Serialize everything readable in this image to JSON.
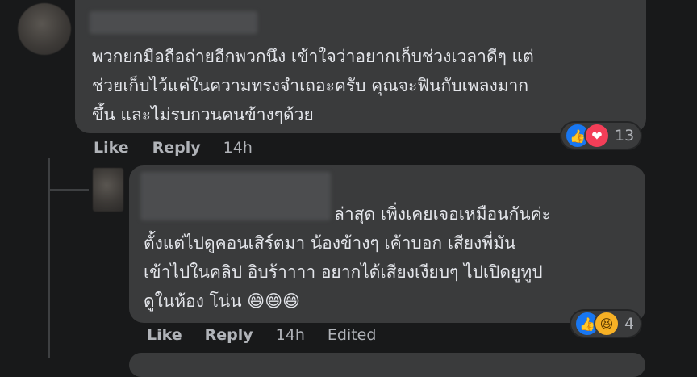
{
  "comment1": {
    "text": "พวกยกมือถือถ่ายอีกพวกนึง เข้าใจว่าอยากเก็บช่วงเวลาดีๆ แต่\nช่วยเก็บไว้แค่ในความทรงจำเถอะครับ คุณจะฟินกับเพลงมาก\nขึ้น และไม่รบกวนคนข้างๆด้วย",
    "actions": {
      "like": "Like",
      "reply": "Reply",
      "time": "14h"
    },
    "reactions": {
      "icons": [
        "like-icon",
        "love-icon"
      ],
      "count": "13"
    }
  },
  "comment2": {
    "text_first": "ล่าสุด เพิ่งเคยเจอเหมือนกันค่ะ",
    "text_rest": "ตั้งแต่ไปดูคอนเสิร์ตมา น้องข้างๆ เค้าบอก เสียงพี่มัน\nเข้าไปในคลิป อิบร้าาาา อยากได้เสียงเงียบๆ ไปเปิดยูทูป\nดูในห้อง โน่น 😄😄😄",
    "actions": {
      "like": "Like",
      "reply": "Reply",
      "time": "14h",
      "edited": "Edited"
    },
    "reactions": {
      "icons": [
        "like-icon",
        "haha-icon"
      ],
      "count": "4"
    }
  },
  "colors": {
    "background": "#18191a",
    "bubble": "#3a3b3c",
    "text": "#e4e6eb",
    "muted": "#b0b3b8",
    "like_blue": "#1877f2",
    "love_red": "#f33e58",
    "haha_yellow": "#f7b125"
  }
}
